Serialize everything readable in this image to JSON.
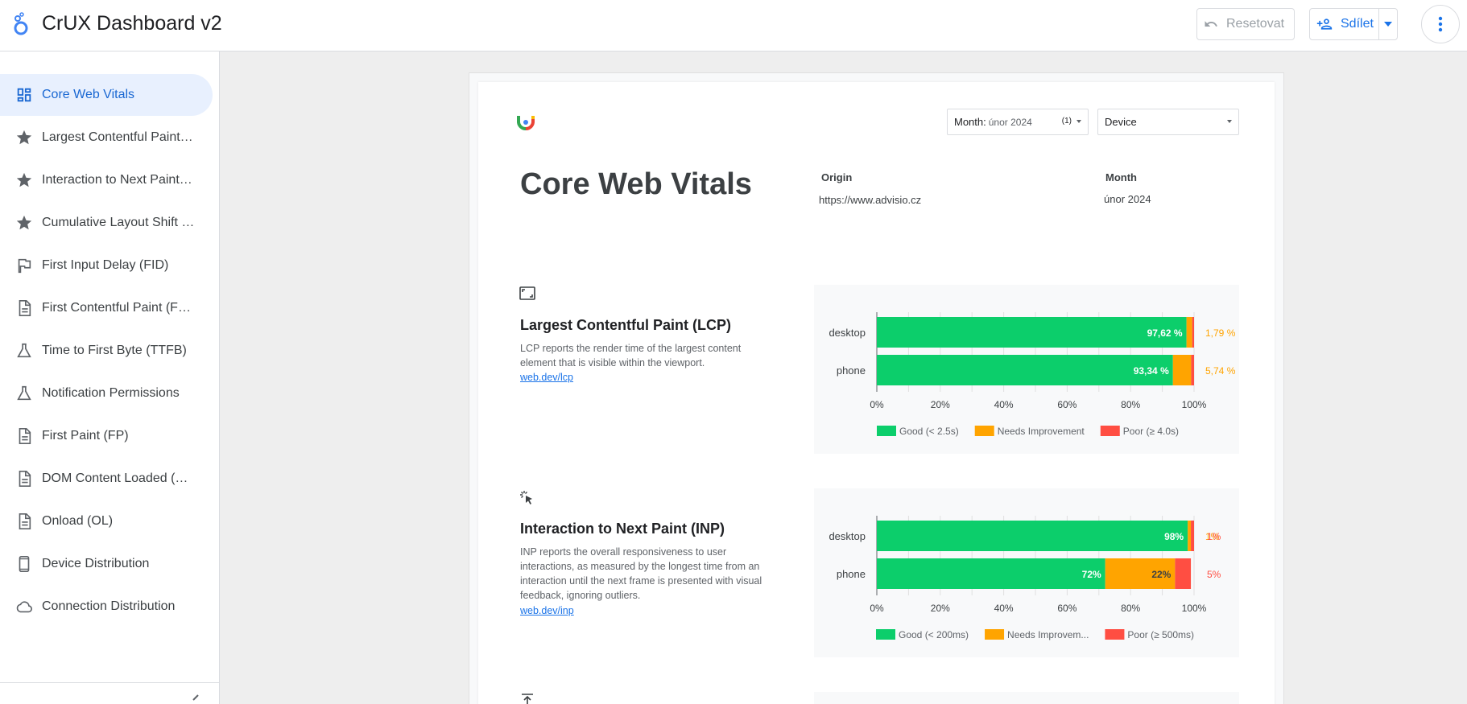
{
  "app": {
    "title": "CrUX Dashboard v2"
  },
  "toolbar": {
    "reset_label": "Resetovat",
    "share_label": "Sdílet"
  },
  "sidebar": {
    "items": [
      {
        "label": "Core Web Vitals",
        "icon": "dashboard-icon",
        "active": true
      },
      {
        "label": "Largest Contentful Paint (LCP)",
        "icon": "star-icon"
      },
      {
        "label": "Interaction to Next Paint (INP)",
        "icon": "star-icon"
      },
      {
        "label": "Cumulative Layout Shift (CLS)",
        "icon": "star-icon"
      },
      {
        "label": "First Input Delay (FID)",
        "icon": "flag-icon"
      },
      {
        "label": "First Contentful Paint (FCP)",
        "icon": "document-icon"
      },
      {
        "label": "Time to First Byte (TTFB)",
        "icon": "flask-icon"
      },
      {
        "label": "Notification Permissions",
        "icon": "flask-icon"
      },
      {
        "label": "First Paint (FP)",
        "icon": "document-icon"
      },
      {
        "label": "DOM Content Loaded (DCL)",
        "icon": "document-icon"
      },
      {
        "label": "Onload (OL)",
        "icon": "document-icon"
      },
      {
        "label": "Device Distribution",
        "icon": "phone-icon"
      },
      {
        "label": "Connection Distribution",
        "icon": "cloud-icon"
      }
    ]
  },
  "report": {
    "filters": {
      "month_label": "Month:",
      "month_value": "únor 2024",
      "month_count": "(1)",
      "device_label": "Device"
    },
    "title": "Core Web Vitals",
    "origin_label": "Origin",
    "origin_value": "https://www.advisio.cz",
    "month_label": "Month",
    "month_value": "únor 2024",
    "sections": [
      {
        "title": "Largest Contentful Paint (LCP)",
        "description": "LCP reports the render time of the largest content element that is visible within the viewport.",
        "link": "web.dev/lcp",
        "icon": "fullscreen-icon"
      },
      {
        "title": "Interaction to Next Paint (INP)",
        "description": "INP reports the overall responsiveness to user interactions, as measured by the longest time from an interaction until the next frame is presented with visual feedback, ignoring outliers.",
        "link": "web.dev/inp",
        "icon": "click-icon"
      }
    ]
  },
  "colors": {
    "good": "#0cce6b",
    "needs": "#ffa400",
    "poor": "#ff4e42",
    "accent": "#1a73e8"
  },
  "chart_data": [
    {
      "type": "bar",
      "orientation": "horizontal",
      "stacked": true,
      "categories": [
        "desktop",
        "phone"
      ],
      "series": [
        {
          "name": "Good (< 2.5s)",
          "values": [
            97.62,
            93.34
          ],
          "labels": [
            "97,62 %",
            "93,34 %"
          ]
        },
        {
          "name": "Needs Improvement",
          "values": [
            1.79,
            5.74
          ],
          "labels": [
            "1,79 %",
            "5,74 %"
          ]
        },
        {
          "name": "Poor (≥ 4.0s)",
          "values": [
            0.59,
            0.92
          ],
          "labels": [
            "",
            ""
          ]
        }
      ],
      "xlim": [
        0,
        100
      ],
      "xticks": [
        "0%",
        "20%",
        "40%",
        "60%",
        "80%",
        "100%"
      ],
      "legend_position": "bottom"
    },
    {
      "type": "bar",
      "orientation": "horizontal",
      "stacked": true,
      "categories": [
        "desktop",
        "phone"
      ],
      "series": [
        {
          "name": "Good (< 200ms)",
          "values": [
            98,
            72
          ],
          "labels": [
            "98%",
            "72%"
          ]
        },
        {
          "name": "Needs Improvem...",
          "values": [
            1,
            22
          ],
          "labels": [
            "1%",
            "22%"
          ]
        },
        {
          "name": "Poor (≥ 500ms)",
          "values": [
            1,
            5
          ],
          "labels": [
            "1%",
            "5%"
          ]
        }
      ],
      "xlim": [
        0,
        100
      ],
      "xticks": [
        "0%",
        "20%",
        "40%",
        "60%",
        "80%",
        "100%"
      ],
      "legend_position": "bottom"
    }
  ]
}
